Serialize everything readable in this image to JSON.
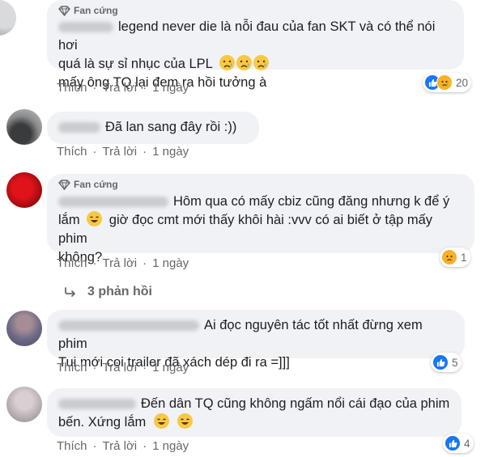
{
  "labels": {
    "badge": "Fan cứng",
    "like": "Thích",
    "reply": "Trả lời",
    "dot": "·"
  },
  "comments": [
    {
      "badge": true,
      "lines": [
        "legend never die là nỗi đau của fan SKT và có thể nói hơi",
        "quá là sự sỉ nhục của LPL",
        "mấy ông TQ lại đem ra hồi tưởng à"
      ],
      "time": "1 ngày",
      "reactions": [
        "like",
        "sad"
      ],
      "reaction_count": "20"
    },
    {
      "badge": false,
      "lines": [
        "Đã lan sang đây rồi :))"
      ],
      "time": "1 ngày",
      "reactions": [],
      "reaction_count": ""
    },
    {
      "badge": true,
      "lines": [
        "Hôm qua có mấy cbiz cũng đăng nhưng k để ý",
        "lắm",
        "giờ đọc cmt mới thấy khôi hài :vvv có ai biết ở tập mấy phim",
        "không?"
      ],
      "time": "1 ngày",
      "reactions": [
        "sad"
      ],
      "reaction_count": "1",
      "replies": "3 phản hồi"
    },
    {
      "badge": false,
      "lines": [
        "Ai đọc nguyên tác tốt nhất đừng xem phim",
        "Tui mới coi trailer đã xách dép đi ra =]]]"
      ],
      "time": "1 ngày",
      "reactions": [
        "like"
      ],
      "reaction_count": "5"
    },
    {
      "badge": false,
      "lines": [
        "Đến dân TQ cũng không ngấm nổi cái đạo của phim",
        "bến. Xứng lắm"
      ],
      "time": "1 ngày",
      "reactions": [
        "like"
      ],
      "reaction_count": "4"
    }
  ],
  "colors": {
    "bubble": "#f0f2f5",
    "secondary_text": "#65676b",
    "like_blue": "#1877f2",
    "sad_yellow": "#f7b125"
  }
}
